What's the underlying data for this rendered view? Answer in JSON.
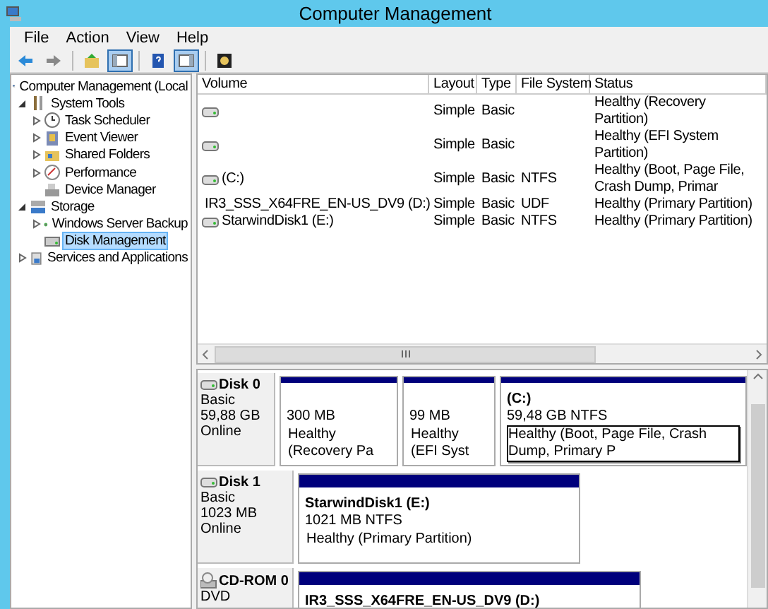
{
  "window": {
    "title": "Computer Management"
  },
  "menu": [
    "File",
    "Action",
    "View",
    "Help"
  ],
  "toolbar": [
    {
      "kind": "back",
      "pressed": false
    },
    {
      "kind": "forward",
      "pressed": false
    },
    {
      "kind": "up",
      "pressed": false
    },
    {
      "kind": "tree",
      "pressed": true
    },
    {
      "kind": "help",
      "pressed": false
    },
    {
      "kind": "pane",
      "pressed": true
    },
    {
      "kind": "disk",
      "pressed": false
    }
  ],
  "tree": [
    {
      "label": "Computer Management (Local",
      "selected": false,
      "children": [
        {
          "label": "System Tools",
          "expanded": true,
          "selected": false,
          "children": [
            {
              "label": "Task Scheduler",
              "expanded": false,
              "selected": false
            },
            {
              "label": "Event Viewer",
              "expanded": false,
              "selected": false
            },
            {
              "label": "Shared Folders",
              "expanded": false,
              "selected": false
            },
            {
              "label": "Performance",
              "expanded": false,
              "selected": false
            },
            {
              "label": "Device Manager",
              "selected": false
            }
          ]
        },
        {
          "label": "Storage",
          "expanded": true,
          "selected": false,
          "children": [
            {
              "label": "Windows Server Backup",
              "expanded": false,
              "selected": false
            },
            {
              "label": "Disk Management",
              "selected": true
            }
          ]
        },
        {
          "label": "Services and Applications",
          "expanded": false,
          "selected": false
        }
      ]
    }
  ],
  "table": {
    "columns": [
      "Volume",
      "Layout",
      "Type",
      "File System",
      "Status"
    ],
    "rows": [
      {
        "kind": "disk",
        "layout": "Simple",
        "type": "Basic",
        "status": "Healthy (Recovery Partition)"
      },
      {
        "kind": "disk",
        "layout": "Simple",
        "type": "Basic",
        "status": "Healthy (EFI System Partition)"
      },
      {
        "kind": "disk",
        "volume": "(C:)",
        "layout": "Simple",
        "type": "Basic",
        "file_system": "NTFS",
        "status": "Healthy (Boot, Page File, Crash Dump, Primar"
      },
      {
        "kind": "cd",
        "volume": "IR3_SSS_X64FRE_EN-US_DV9 (D:)",
        "layout": "Simple",
        "type": "Basic",
        "file_system": "UDF",
        "status": "Healthy (Primary Partition)"
      },
      {
        "kind": "disk",
        "volume": "StarwindDisk1 (E:)",
        "layout": "Simple",
        "type": "Basic",
        "file_system": "NTFS",
        "status": "Healthy (Primary Partition)"
      }
    ]
  },
  "disks": [
    {
      "kind": "disk",
      "name": "Disk 0",
      "lines": [
        "Basic",
        "59,88 GB",
        "Online"
      ],
      "partitions": [
        {
          "size": "300 MB",
          "status": "Healthy (Recovery Pa",
          "selected": false
        },
        {
          "size": "99 MB",
          "status": "Healthy (EFI Syst",
          "selected": false
        },
        {
          "name": "(C:)",
          "size": "59,48 GB NTFS",
          "status": "Healthy (Boot, Page File, Crash Dump, Primary P",
          "selected": true
        }
      ]
    },
    {
      "kind": "disk",
      "name": "Disk 1",
      "lines": [
        "Basic",
        "1023 MB",
        "Online"
      ],
      "partitions": [
        {
          "name": "StarwindDisk1  (E:)",
          "size": "1021 MB NTFS",
          "status": "Healthy (Primary Partition)",
          "selected": false
        }
      ]
    },
    {
      "kind": "cd",
      "name": "CD-ROM 0",
      "lines": [
        "DVD"
      ],
      "partitions": [
        {
          "name": "IR3_SSS_X64FRE_EN-US_DV9  (D:)"
        }
      ]
    }
  ]
}
